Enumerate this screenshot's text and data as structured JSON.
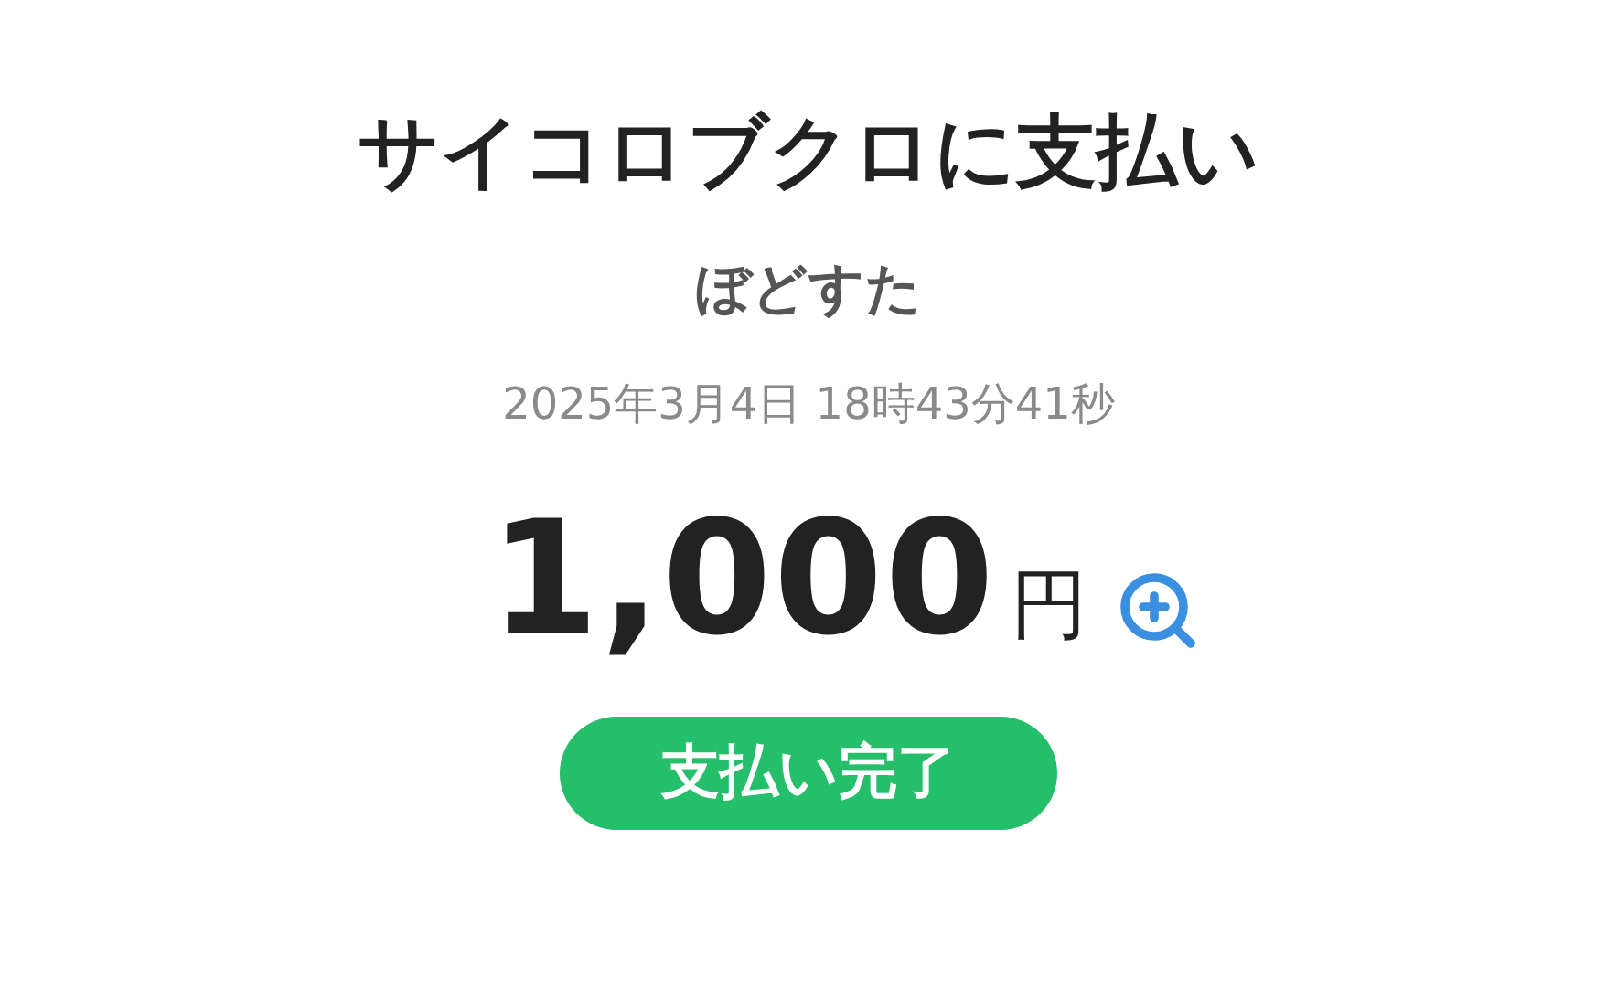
{
  "title": "サイコロブクロに支払い",
  "recipient": "ぼどすた",
  "timestamp": "2025年3月4日 18時43分41秒",
  "amount": {
    "value": "1,000",
    "unit": "円"
  },
  "status": {
    "label": "支払い完了",
    "kind": "completed"
  }
}
